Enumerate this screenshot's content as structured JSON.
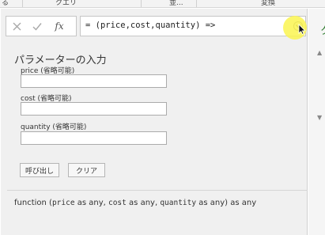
{
  "top_tabs": [
    {
      "label": "る"
    },
    {
      "label": "クエリ"
    },
    {
      "label": "並..."
    },
    {
      "label": "変換"
    }
  ],
  "formula_bar": {
    "cancel_icon": "x-icon",
    "confirm_icon": "check-icon",
    "fx_label": "fx",
    "formula": "= (price,cost,quantity) =>",
    "expand_icon": "chevron-down-icon"
  },
  "parameters": {
    "title": "パラメーターの入力",
    "fields": [
      {
        "label": "price (省略可能)",
        "value": ""
      },
      {
        "label": "cost (省略可能)",
        "value": ""
      },
      {
        "label": "quantity (省略可能)",
        "value": ""
      }
    ],
    "invoke_label": "呼び出し",
    "clear_label": "クリア"
  },
  "signature": {
    "prefix": "function (",
    "p1": "price",
    "as1": " as any, ",
    "p2": "cost",
    "as2": " as any, ",
    "p3": "quantity",
    "suffix": " as any) as any"
  },
  "right_pane": {
    "letter": "ク"
  },
  "colors": {
    "panel_bg": "#f0f0f0",
    "cursor_highlight": "#faf550",
    "right_pane_accent": "#2b7a2b"
  }
}
